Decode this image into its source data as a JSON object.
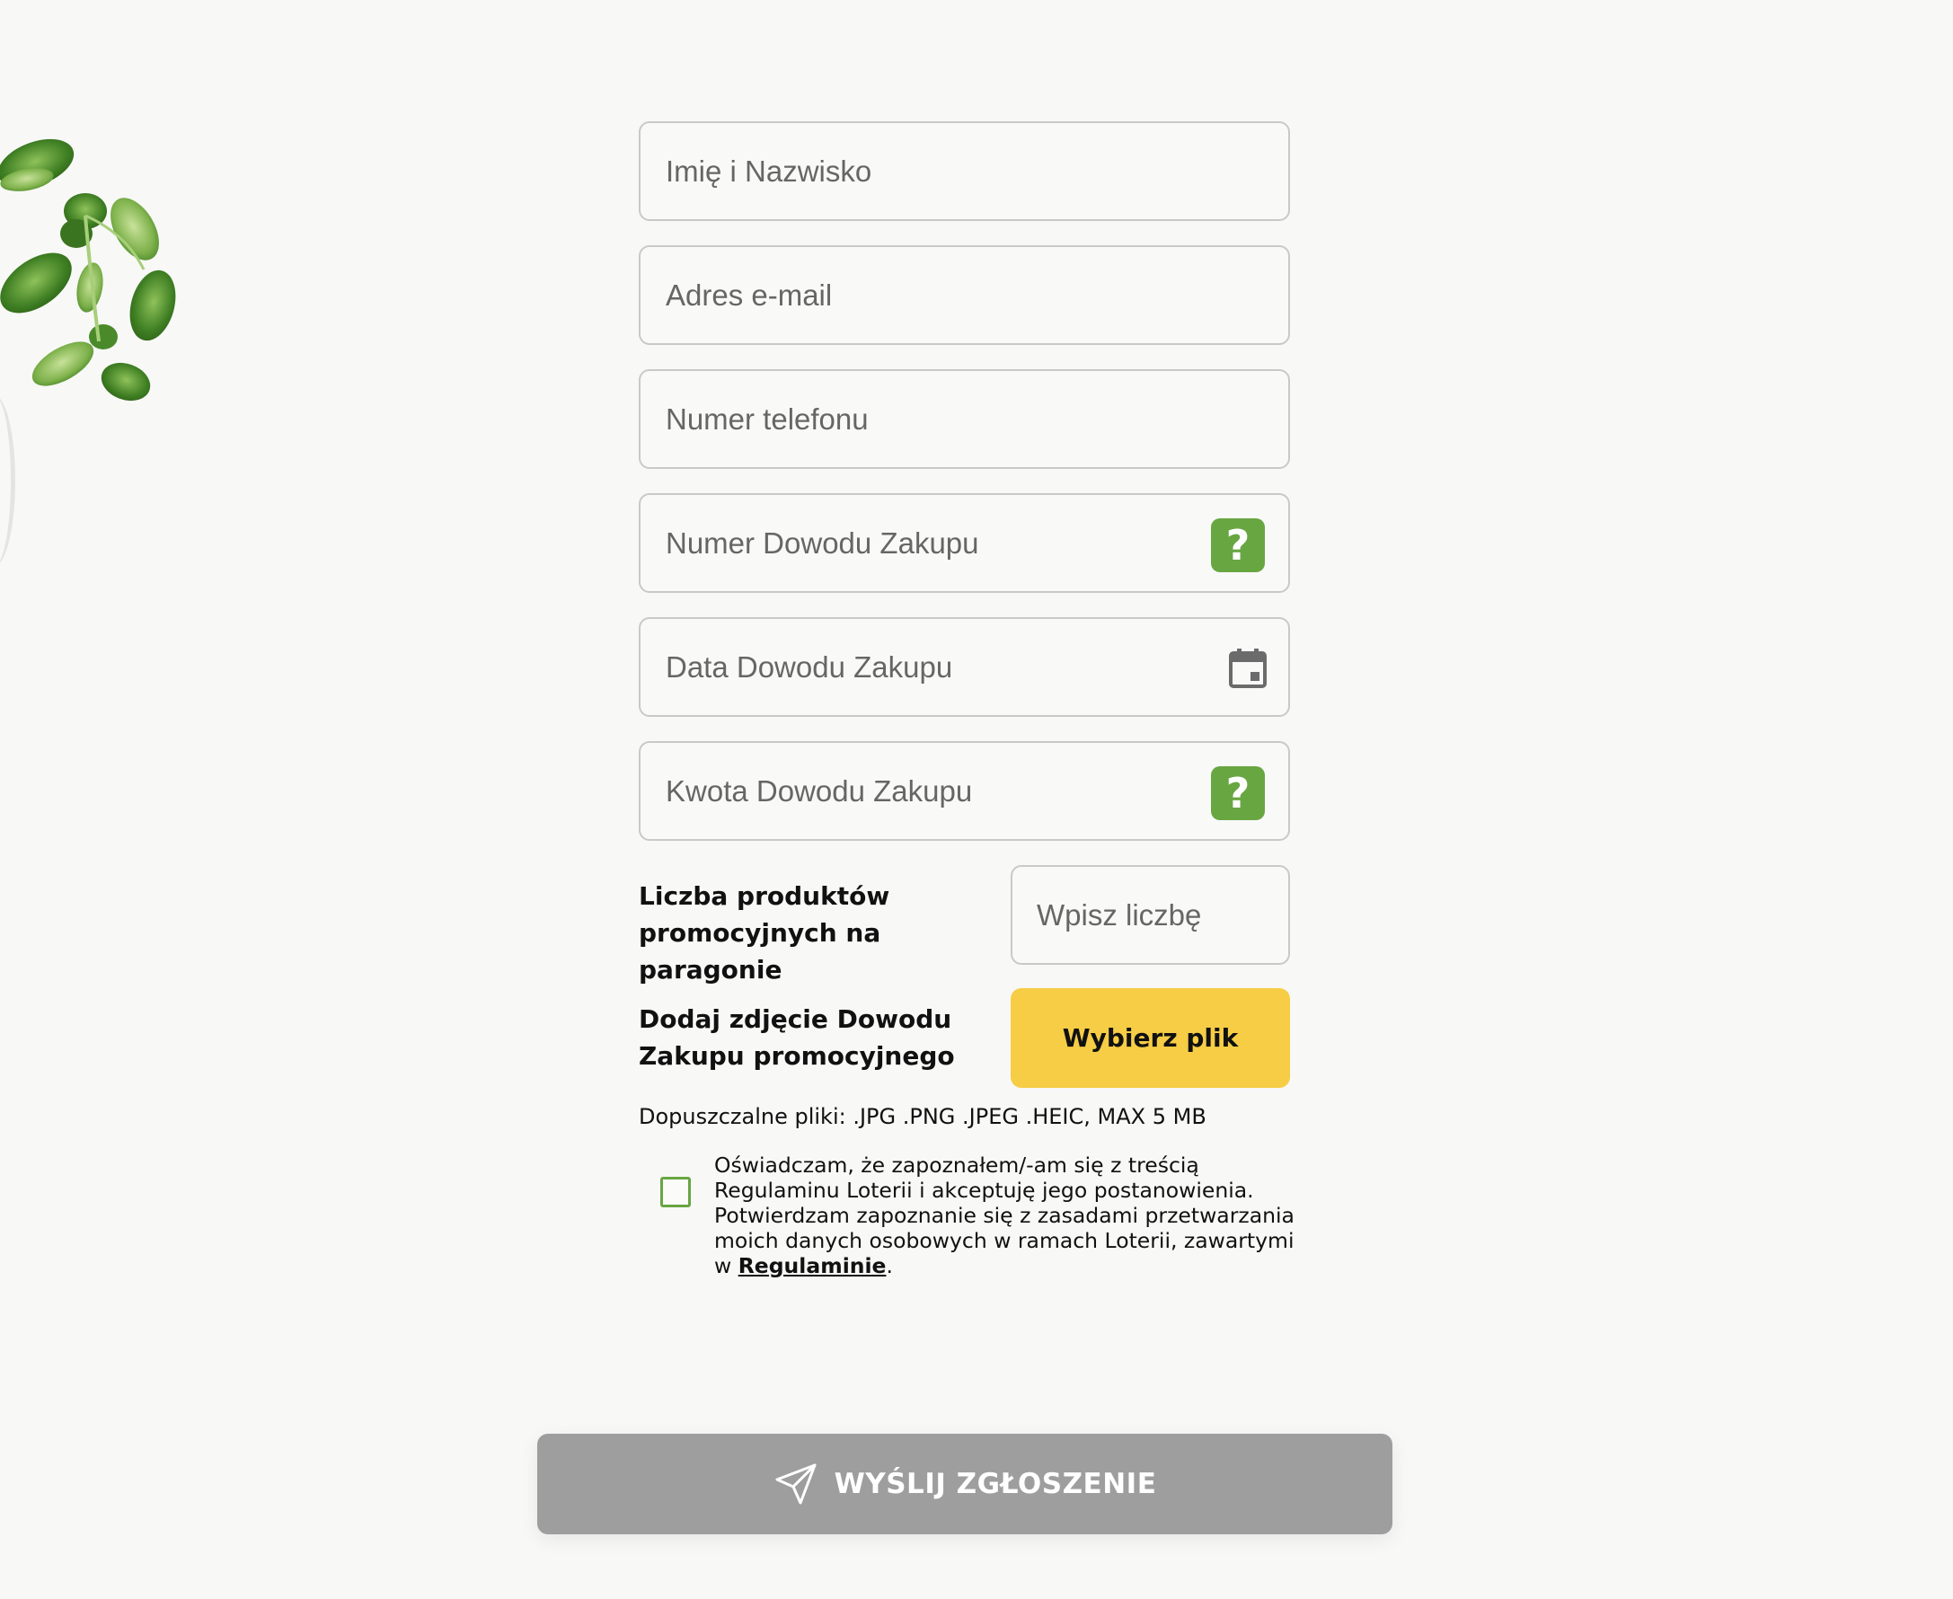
{
  "form": {
    "full_name_placeholder": "Imię i Nazwisko",
    "email_placeholder": "Adres e-mail",
    "phone_placeholder": "Numer telefonu",
    "receipt_number_placeholder": "Numer Dowodu Zakupu",
    "receipt_date_placeholder": "Data Dowodu Zakupu",
    "receipt_amount_placeholder": "Kwota Dowodu Zakupu",
    "help_symbol": "?",
    "product_count_label_line1": "Liczba produktów",
    "product_count_label_line2": "promocyjnych na paragonie",
    "product_count_placeholder": "Wpisz liczbę",
    "photo_label_line1": "Dodaj zdjęcie Dowodu",
    "photo_label_line2": "Zakupu promocyjnego",
    "choose_file_label": "Wybierz plik",
    "allowed_files_text": "Dopuszczalne pliki: .JPG .PNG .JPEG .HEIC, MAX 5 MB"
  },
  "consent": {
    "text_before_link": "Oświadczam, że zapoznałem/-am się z treścią Regulaminu Loterii i akceptuję jego postanowienia. Potwierdzam zapoznanie się z zasadami przetwarzania moich danych osobowych w ramach Loterii, zawartymi w ",
    "link_text": "Regulaminie",
    "text_after_link": ".",
    "checked": false
  },
  "submit": {
    "label": "WYŚLIJ ZGŁOSZENIE",
    "icon": "send-icon"
  },
  "colors": {
    "accent_green": "#68a642",
    "file_button_yellow": "#f6cd45",
    "submit_disabled_gray": "#9e9e9e",
    "background": "#f8f8f7"
  },
  "icons": {
    "help": "question-mark-icon",
    "date": "calendar-icon",
    "decoration": "lambs-lettuce-leaves"
  }
}
